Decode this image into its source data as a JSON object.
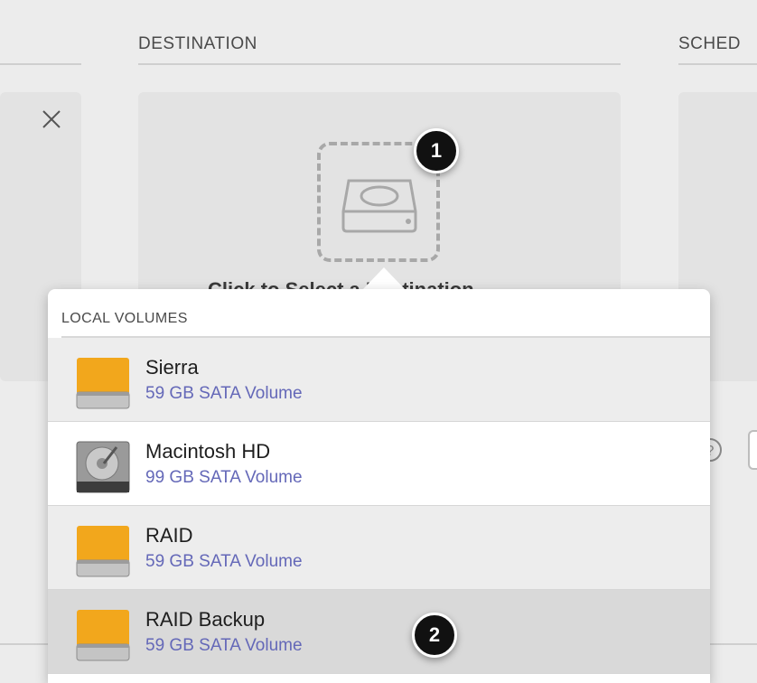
{
  "columns": {
    "destination": "DESTINATION",
    "schedule": "SCHED"
  },
  "destination_panel": {
    "badge_1": "1",
    "hidden_label": "Click to Select a Destination"
  },
  "popover": {
    "section_title": "LOCAL VOLUMES",
    "volumes": [
      {
        "name": "Sierra",
        "desc": "59 GB SATA Volume",
        "icon": "orange-drive-icon"
      },
      {
        "name": "Macintosh HD",
        "desc": "99 GB SATA Volume",
        "icon": "internal-drive-icon"
      },
      {
        "name": "RAID",
        "desc": "59 GB SATA Volume",
        "icon": "orange-drive-icon"
      },
      {
        "name": "RAID Backup",
        "desc": "59 GB SATA Volume",
        "icon": "orange-drive-icon"
      }
    ],
    "badge_2": "2"
  },
  "colors": {
    "background": "#ececec",
    "panel": "#e3e3e3",
    "volume_desc": "#6468b8",
    "drive_orange": "#f2a71c",
    "badge": "#111111"
  }
}
